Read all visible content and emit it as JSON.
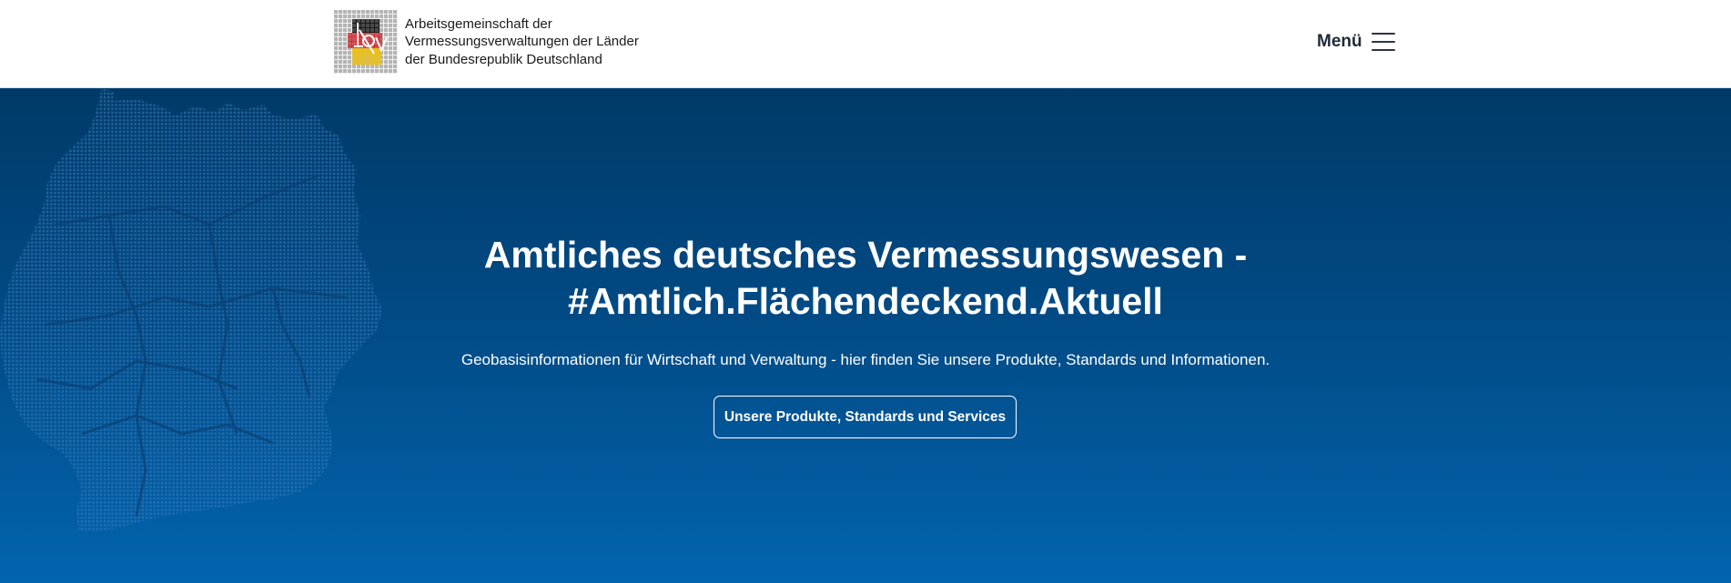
{
  "header": {
    "logo_icon": "adv-logo-icon",
    "logo_lines": [
      "Arbeitsgemeinschaft der",
      "Vermessungsverwaltungen der Länder",
      "der Bundesrepublik Deutschland"
    ],
    "menu_label": "Menü",
    "menu_icon": "hamburger-menu-icon"
  },
  "hero": {
    "background_icon": "germany-map-dotted-icon",
    "title_lines": [
      "Amtliches deutsches Vermessungswesen -",
      "#Amtlich.Flächendeckend.Aktuell"
    ],
    "subtitle": "Geobasisinformationen für Wirtschaft und Verwaltung - hier finden Sie unsere Produkte, Standards und Informationen.",
    "cta_label": "Unsere Produkte, Standards und Services"
  },
  "colors": {
    "hero_top": "#003a68",
    "hero_bottom": "#0264ae",
    "flag_black": "#111111",
    "flag_red": "#d8232a",
    "flag_gold": "#f3c300"
  }
}
